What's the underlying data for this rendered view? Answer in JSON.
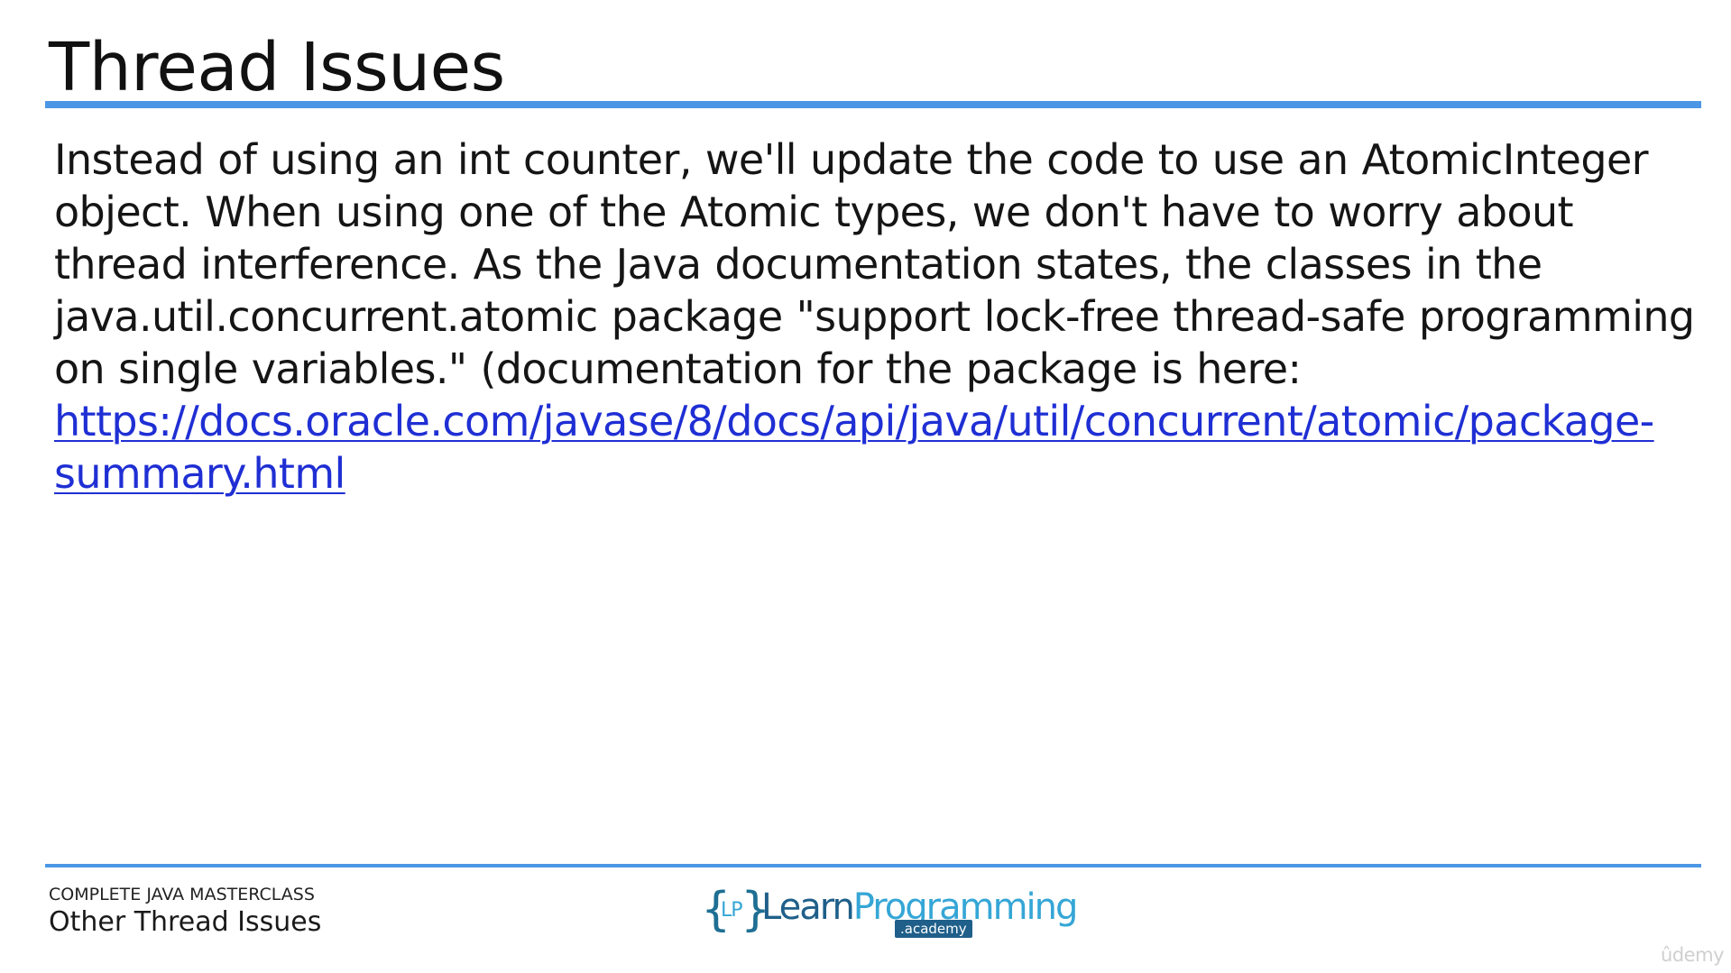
{
  "slide": {
    "title": "Thread Issues",
    "body": "Instead of using an int counter, we'll update the code to use an AtomicInteger object. When using one of the Atomic types, we don't have to worry about thread interference. As the Java documentation states, the classes in the java.util.concurrent.atomic package \"support lock-free thread-safe programming on single variables.\"  (documentation for the package is here: ",
    "link": "https://docs.oracle.com/javase/8/docs/api/java/util/concurrent/atomic/package-summary.html",
    "colors": {
      "accent": "#4b97e5",
      "link": "#1f2fd4"
    }
  },
  "footer": {
    "course": "COMPLETE JAVA MASTERCLASS",
    "lecture": "Other Thread Issues",
    "logo": {
      "brace_open": "{",
      "mark": "LP",
      "brace_close": "}",
      "brand_part1": "Learn",
      "brand_part2": "Programming",
      "tagline": ".academy",
      "colors": {
        "dark": "#1f5f8a",
        "light": "#35a6d6"
      }
    },
    "watermark": "ûdemy"
  }
}
